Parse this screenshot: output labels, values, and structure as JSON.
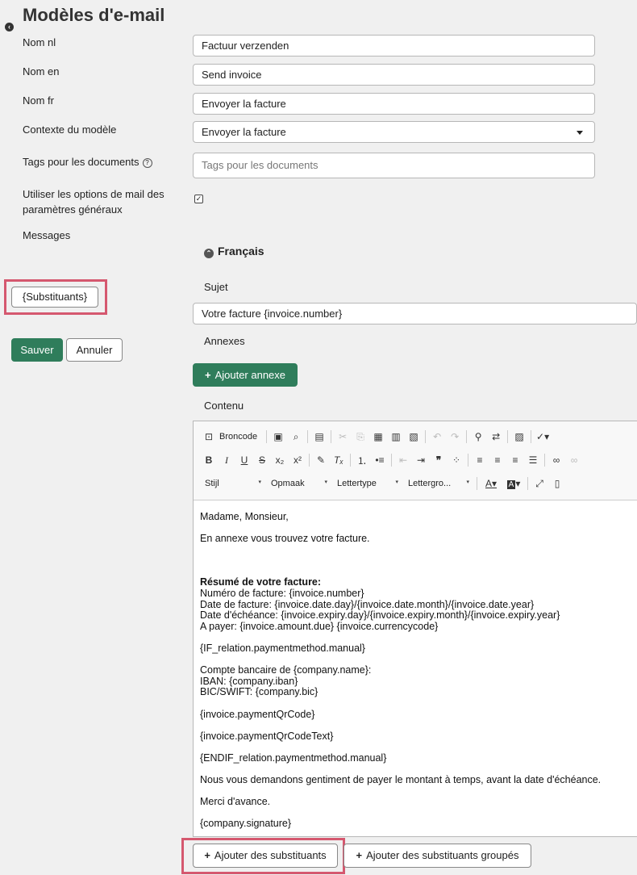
{
  "page": {
    "title": "Modèles d'e-mail"
  },
  "fields": {
    "nom_nl": {
      "label": "Nom nl",
      "value": "Factuur verzenden"
    },
    "nom_en": {
      "label": "Nom en",
      "value": "Send invoice"
    },
    "nom_fr": {
      "label": "Nom fr",
      "value": "Envoyer la facture"
    },
    "contexte": {
      "label": "Contexte du modèle",
      "value": "Envoyer la facture"
    },
    "tags": {
      "label": "Tags pour les documents",
      "placeholder": "Tags pour les documents"
    },
    "options_line1": "Utiliser les options de mail des",
    "options_line2": "paramètres généraux",
    "messages": "Messages"
  },
  "left_buttons": {
    "substituants": "{Substituants}",
    "save": "Sauver",
    "cancel": "Annuler"
  },
  "message_section": {
    "language": "Français",
    "subject_label": "Sujet",
    "subject_value": "Votre facture {invoice.number}",
    "attachments_label": "Annexes",
    "add_attachment": "Ajouter annexe",
    "content_label": "Contenu"
  },
  "editor": {
    "source_label": "Broncode",
    "style_combo": "Stijl",
    "format_combo": "Opmaak",
    "font_combo": "Lettertype",
    "size_combo": "Lettergro...",
    "content": {
      "greeting": "Madame, Monsieur,",
      "intro": "En annexe vous trouvez votre facture.",
      "summary_title": "Résumé de votre facture:",
      "summary_lines": [
        "Numéro de facture: {invoice.number}",
        "Date de facture: {invoice.date.day}/{invoice.date.month}/{invoice.date.year}",
        "Date d'échéance: {invoice.expiry.day}/{invoice.expiry.month}/{invoice.expiry.year}",
        "A payer: {invoice.amount.due} {invoice.currencycode}"
      ],
      "if_line": "{IF_relation.paymentmethod.manual}",
      "bank_lines": [
        "Compte bancaire de {company.name}:",
        "IBAN: {company.iban}",
        "BIC/SWIFT: {company.bic}"
      ],
      "qr": "{invoice.paymentQrCode}",
      "qr_text": "{invoice.paymentQrCodeText}",
      "endif_line": "{ENDIF_relation.paymentmethod.manual}",
      "request": "Nous vous demandons gentiment de payer le montant à temps, avant la date d'échéance.",
      "thanks": "Merci d'avance.",
      "signature": "{company.signature}"
    }
  },
  "bottom_buttons": {
    "add_substituants": "Ajouter des substituants",
    "add_grouped": "Ajouter des substituants groupés"
  },
  "colors": {
    "primary": "#2f7d5b",
    "highlight": "#d5586f",
    "background": "#f0f0f0"
  }
}
